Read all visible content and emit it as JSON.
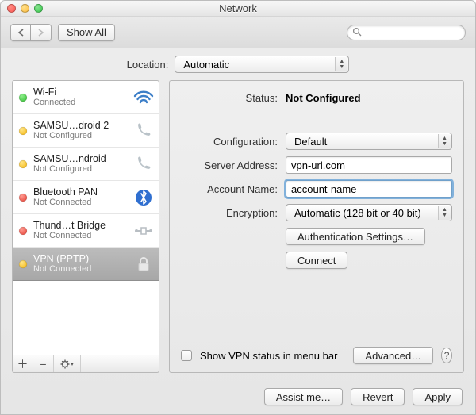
{
  "window": {
    "title": "Network"
  },
  "toolbar": {
    "show_all": "Show All",
    "search_placeholder": ""
  },
  "location": {
    "label": "Location:",
    "selected": "Automatic"
  },
  "services": [
    {
      "name": "Wi-Fi",
      "status_label": "Connected",
      "status_dot": "green",
      "icon": "wifi"
    },
    {
      "name": "SAMSU…droid 2",
      "status_label": "Not Configured",
      "status_dot": "yellow",
      "icon": "phone"
    },
    {
      "name": "SAMSU…ndroid",
      "status_label": "Not Configured",
      "status_dot": "yellow",
      "icon": "phone"
    },
    {
      "name": "Bluetooth PAN",
      "status_label": "Not Connected",
      "status_dot": "red",
      "icon": "bluetooth"
    },
    {
      "name": "Thund…t Bridge",
      "status_label": "Not Connected",
      "status_dot": "red",
      "icon": "ethernet"
    },
    {
      "name": "VPN (PPTP)",
      "status_label": "Not Connected",
      "status_dot": "yellow",
      "icon": "lock",
      "selected": true
    }
  ],
  "detail": {
    "status_label": "Status:",
    "status_value": "Not Configured",
    "config_label": "Configuration:",
    "config_value": "Default",
    "server_label": "Server Address:",
    "server_value": "vpn-url.com",
    "account_label": "Account Name:",
    "account_value": "account-name",
    "encryption_label": "Encryption:",
    "encryption_value": "Automatic (128 bit or 40 bit)",
    "auth_button": "Authentication Settings…",
    "connect_button": "Connect",
    "show_status_label": "Show VPN status in menu bar",
    "advanced_button": "Advanced…"
  },
  "footer": {
    "assist": "Assist me…",
    "revert": "Revert",
    "apply": "Apply"
  }
}
